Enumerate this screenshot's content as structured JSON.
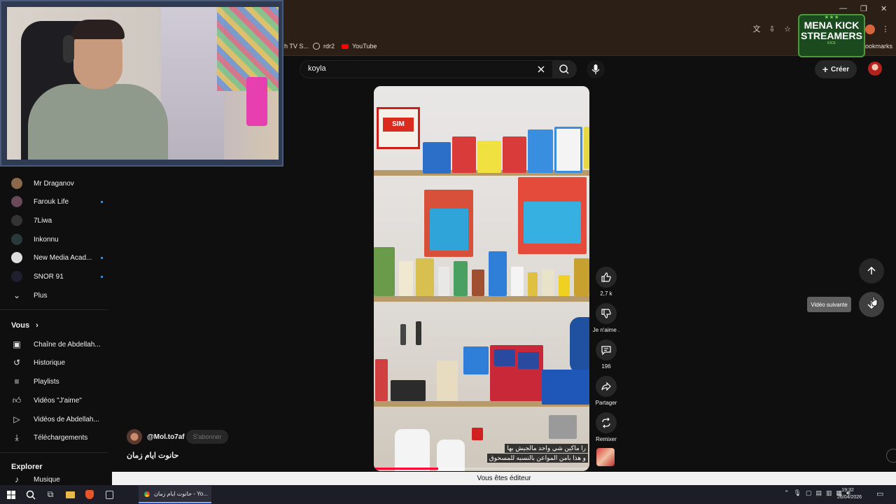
{
  "browser": {
    "bookmarks": [
      {
        "label": "h TV S...",
        "icon": "tv-icon"
      },
      {
        "label": "rdr2",
        "icon": "globe-icon"
      },
      {
        "label": "YouTube",
        "icon": "youtube-icon"
      }
    ],
    "bookmarks_folder": "ookmarks"
  },
  "overlay": {
    "logo_line1": "MENA KICK",
    "logo_line2": "STREAMERS",
    "logo_sub": "KICK"
  },
  "header": {
    "search_value": "koyla",
    "create_label": "Créer"
  },
  "sidebar": {
    "subscriptions": [
      {
        "name": "Mr Draganov",
        "color": "#8a6a4a",
        "new": false
      },
      {
        "name": "Farouk Life",
        "color": "#6a4a5a",
        "new": true
      },
      {
        "name": "7Liwa",
        "color": "#333333",
        "new": false
      },
      {
        "name": "Inkonnu",
        "color": "#2a3a3a",
        "new": false
      },
      {
        "name": "New Media Acad...",
        "color": "#dddddd",
        "new": true
      },
      {
        "name": "SNOR 91",
        "color": "#1f1f2f",
        "new": true
      }
    ],
    "more_label": "Plus",
    "you_title": "Vous",
    "you_items": [
      {
        "label": "Chaîne de Abdellah...",
        "icon": "channel-icon"
      },
      {
        "label": "Historique",
        "icon": "history-icon"
      },
      {
        "label": "Playlists",
        "icon": "playlists-icon"
      },
      {
        "label": "Vidéos \"J'aime\"",
        "icon": "like-icon"
      },
      {
        "label": "Vidéos de Abdellah...",
        "icon": "video-icon"
      },
      {
        "label": "Téléchargements",
        "icon": "download-icon"
      }
    ],
    "explore_title": "Explorer",
    "explore_items": [
      {
        "label": "Musique",
        "icon": "music-icon"
      }
    ]
  },
  "short": {
    "channel": "@Mol.to7af",
    "subscribe_label": "S'abonner",
    "title": "حانوت ايام زمان",
    "caption_line1": "را ماكين شي واحد مالجيش بها",
    "caption_line2": "و هذا بامن المواعن بالنسبه للمسحوق",
    "sign_text": "SIM",
    "actions": {
      "like_count": "2,7 k",
      "dislike_label": "Je n'aime .",
      "comments_count": "196",
      "share_label": "Partager",
      "remix_label": "Remixer"
    },
    "next_tooltip": "Vidéo suivante"
  },
  "footer": {
    "editor_notice": "Vous êtes éditeur"
  },
  "taskbar": {
    "chrome_tab": "حانوت ايام زمان - Yo...",
    "time": "19:32",
    "date": "26/04/2026"
  }
}
